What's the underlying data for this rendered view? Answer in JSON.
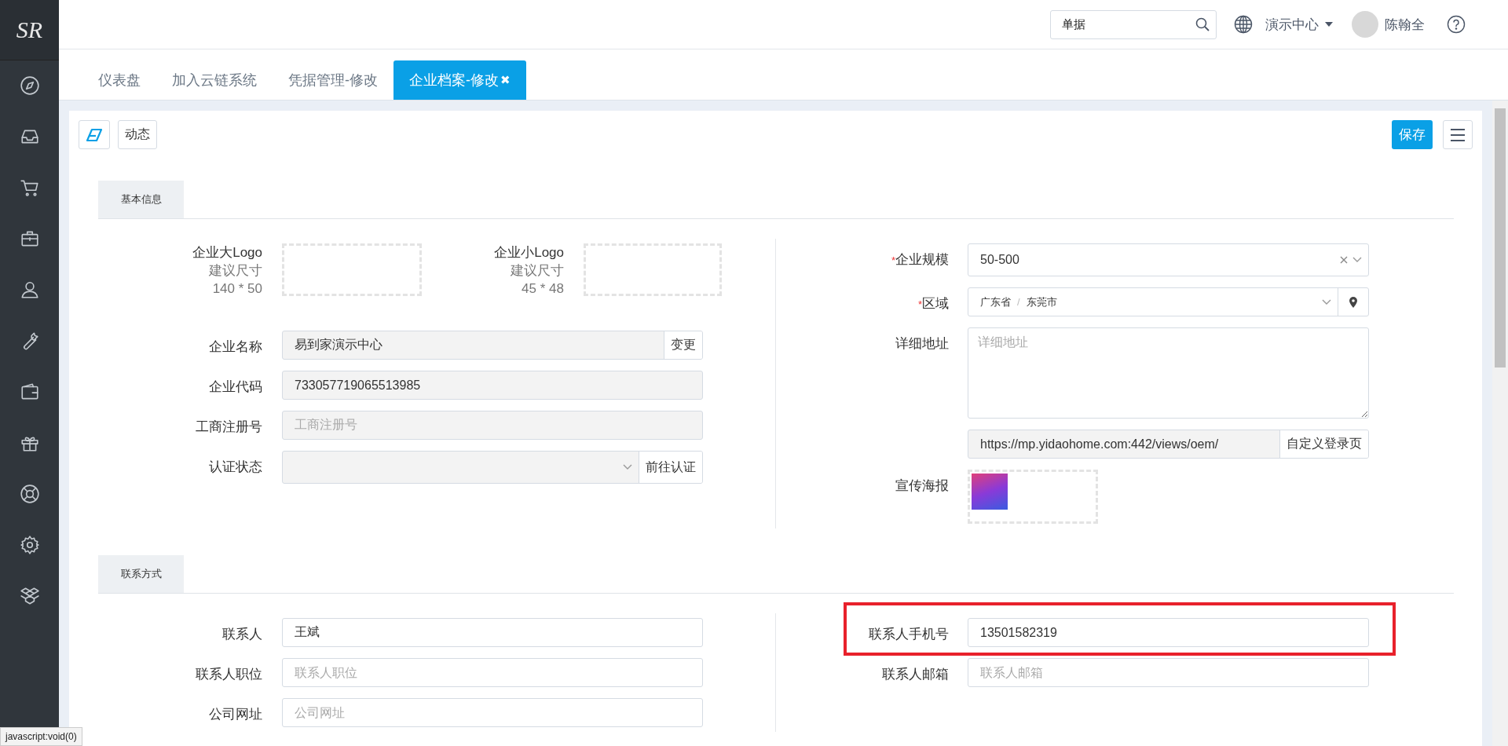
{
  "sidebar": {
    "logo": "SR"
  },
  "header": {
    "search": {
      "value": "单据"
    },
    "org": "演示中心",
    "user": "陈翰全"
  },
  "tabs": [
    {
      "label": "仪表盘",
      "selected": false
    },
    {
      "label": "加入云链系统",
      "selected": false
    },
    {
      "label": "凭据管理-修改",
      "selected": false
    },
    {
      "label": "企业档案-修改",
      "selected": true,
      "close": "✖"
    }
  ],
  "toolbar": {
    "buttons": [
      "动态"
    ],
    "save": "保存"
  },
  "basic_info": {
    "title": "基本信息",
    "logos": [
      {
        "label": "企业大Logo",
        "hint": "建议尺寸",
        "size": "140 * 50"
      },
      {
        "label": "企业小Logo",
        "hint": "建议尺寸",
        "size": "45 * 48"
      }
    ],
    "left_fields": [
      {
        "kind": "input-button",
        "label": "企业名称",
        "value": "易到家演示中心",
        "button": "变更",
        "disabled": true
      },
      {
        "kind": "input",
        "label": "企业代码",
        "value": "733057719065513985",
        "disabled": true
      },
      {
        "kind": "input",
        "label": "工商注册号",
        "placeholder": "工商注册号",
        "disabled": true
      },
      {
        "kind": "select-button",
        "label": "认证状态",
        "button": "前往认证",
        "disabled": true
      }
    ],
    "right_fields": [
      {
        "kind": "select",
        "label": "企业规模",
        "required_mark": "*",
        "value": "50-500",
        "clearable": true
      },
      {
        "kind": "cascader",
        "label": "区域",
        "required_mark": "*",
        "values": [
          "广东省",
          "东莞市"
        ],
        "separator": "/"
      },
      {
        "kind": "textarea",
        "label": "详细地址",
        "placeholder": "详细地址"
      },
      {
        "kind": "input-button",
        "value": "https://mp.yidaohome.com:442/views/oem/",
        "button": "自定义登录页",
        "disabled": true
      },
      {
        "kind": "poster",
        "label": "宣传海报"
      }
    ]
  },
  "contact": {
    "title": "联系方式",
    "left_fields": [
      {
        "kind": "input",
        "label": "联系人",
        "value": "王斌",
        "disabled": false
      },
      {
        "kind": "input",
        "label": "联系人职位",
        "placeholder": "联系人职位",
        "disabled": false
      },
      {
        "kind": "input",
        "label": "公司网址",
        "placeholder": "公司网址",
        "disabled": false
      }
    ],
    "right_fields": [
      {
        "kind": "input",
        "label": "联系人手机号",
        "value": "13501582319",
        "disabled": false,
        "highlighted": true
      },
      {
        "kind": "input",
        "label": "联系人邮箱",
        "placeholder": "联系人邮箱",
        "disabled": false
      }
    ]
  },
  "status_bar": "javascript:void(0)"
}
